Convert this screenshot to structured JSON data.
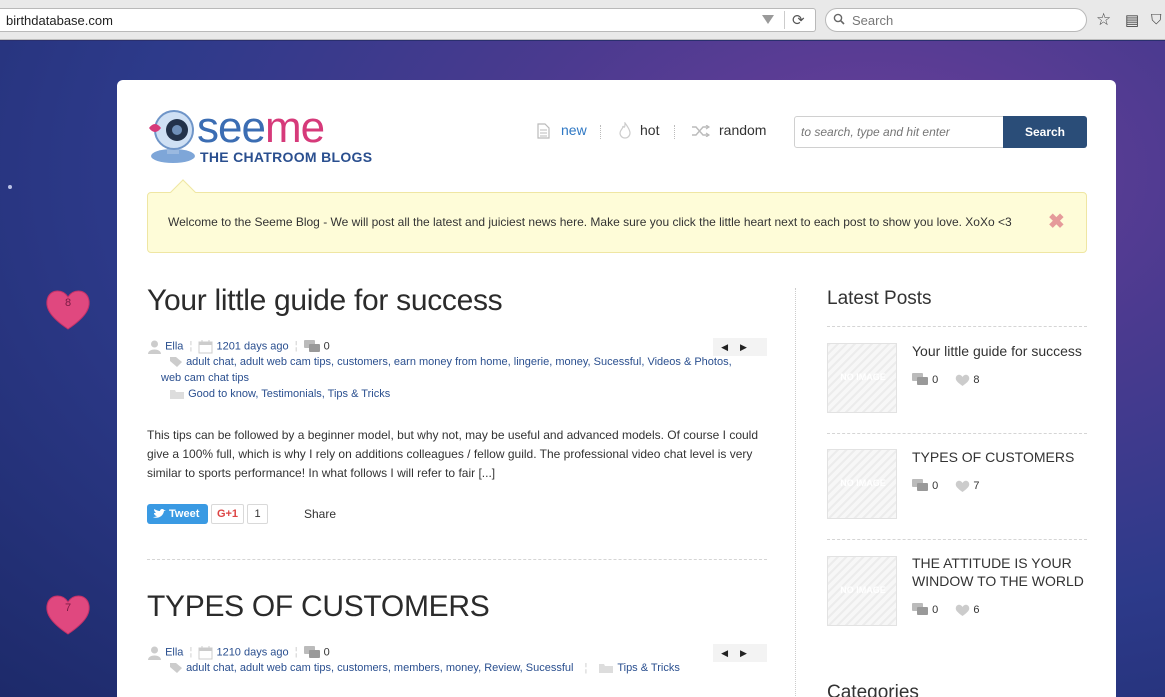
{
  "browser": {
    "url": "birthdatabase.com",
    "search_placeholder": "Search"
  },
  "hearts": [
    "8",
    "7"
  ],
  "header": {
    "logo_word_a": "see",
    "logo_word_b": "me",
    "logo_tagline": "THE CHATROOM BLOGS",
    "nav": {
      "new": "new",
      "hot": "hot",
      "random": "random"
    },
    "search_placeholder": "to search, type and hit enter",
    "search_button": "Search"
  },
  "notice": {
    "text": "Welcome to the Seeme Blog - We will post all the latest and juiciest news here. Make sure you click the little heart next to each post to show you love. XoXo <3",
    "close": "✖"
  },
  "posts": [
    {
      "title": "Your little guide for success",
      "author": "Ella",
      "age": "1201 days ago",
      "comments": "0",
      "tags_line1": "adult chat,  adult web cam tips,  customers,  earn money from home,  lingerie,  money,  Sucessful,  Videos & Photos,",
      "tags_line2": "web cam chat tips",
      "categories": "Good to know,  Testimonials,  Tips & Tricks",
      "excerpt": "This tips can be followed by a beginner model, but why not, may be useful and advanced models. Of course  I could give a 100% full, which is why I rely on additions colleagues / fellow guild. The professional video chat level is very similar to sports performance! In what follows I will refer to fair [...]",
      "tweet": "Tweet",
      "gplus": "G+1",
      "gplus_count": "1",
      "share": "Share"
    },
    {
      "title": "TYPES OF CUSTOMERS",
      "author": "Ella",
      "age": "1210 days ago",
      "comments": "0",
      "tags_line1": "adult chat,  adult web cam tips,  customers,  members,  money,  Review,  Sucessful",
      "categories": "Tips & Tricks"
    }
  ],
  "sidebar": {
    "heading": "Latest Posts",
    "heading2": "Categories",
    "thumb_label": "NO IMAGE",
    "items": [
      {
        "title": "Your little guide for success",
        "comments": "0",
        "likes": "8"
      },
      {
        "title": "TYPES OF CUSTOMERS",
        "comments": "0",
        "likes": "7"
      },
      {
        "title": "THE ATTITUDE IS YOUR WINDOW TO THE WORLD",
        "comments": "0",
        "likes": "6"
      }
    ]
  },
  "colors": {
    "brand_blue": "#3b6db3",
    "brand_pink": "#d63a7a",
    "search_button": "#2a4d78",
    "notice_bg": "#fefcd8",
    "heart": "#e0487f"
  }
}
